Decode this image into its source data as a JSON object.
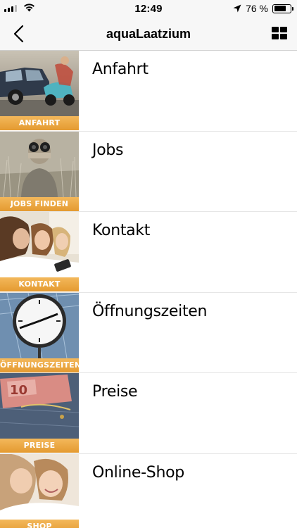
{
  "status_bar": {
    "time": "12:49",
    "battery_label": "76 %",
    "battery_level_percent": 76
  },
  "nav": {
    "title": "aquaLaatzium",
    "back_icon": "chevron-left-icon",
    "grid_icon": "grid-view-icon"
  },
  "items": [
    {
      "label": "Anfahrt",
      "tag": "ANFAHRT",
      "photo": "car-scooter-photo"
    },
    {
      "label": "Jobs",
      "tag": "JOBS FINDEN",
      "photo": "binoculars-photo"
    },
    {
      "label": "Kontakt",
      "tag": "KONTAKT",
      "photo": "women-phone-photo"
    },
    {
      "label": "Öffnungszeiten",
      "tag": "ÖFFNUNGSZEITEN",
      "photo": "station-clock-photo"
    },
    {
      "label": "Preise",
      "tag": "PREISE",
      "photo": "euro-notes-jeans-photo"
    },
    {
      "label": "Online-Shop",
      "tag": "SHOP",
      "photo": "mother-child-photo"
    }
  ]
}
